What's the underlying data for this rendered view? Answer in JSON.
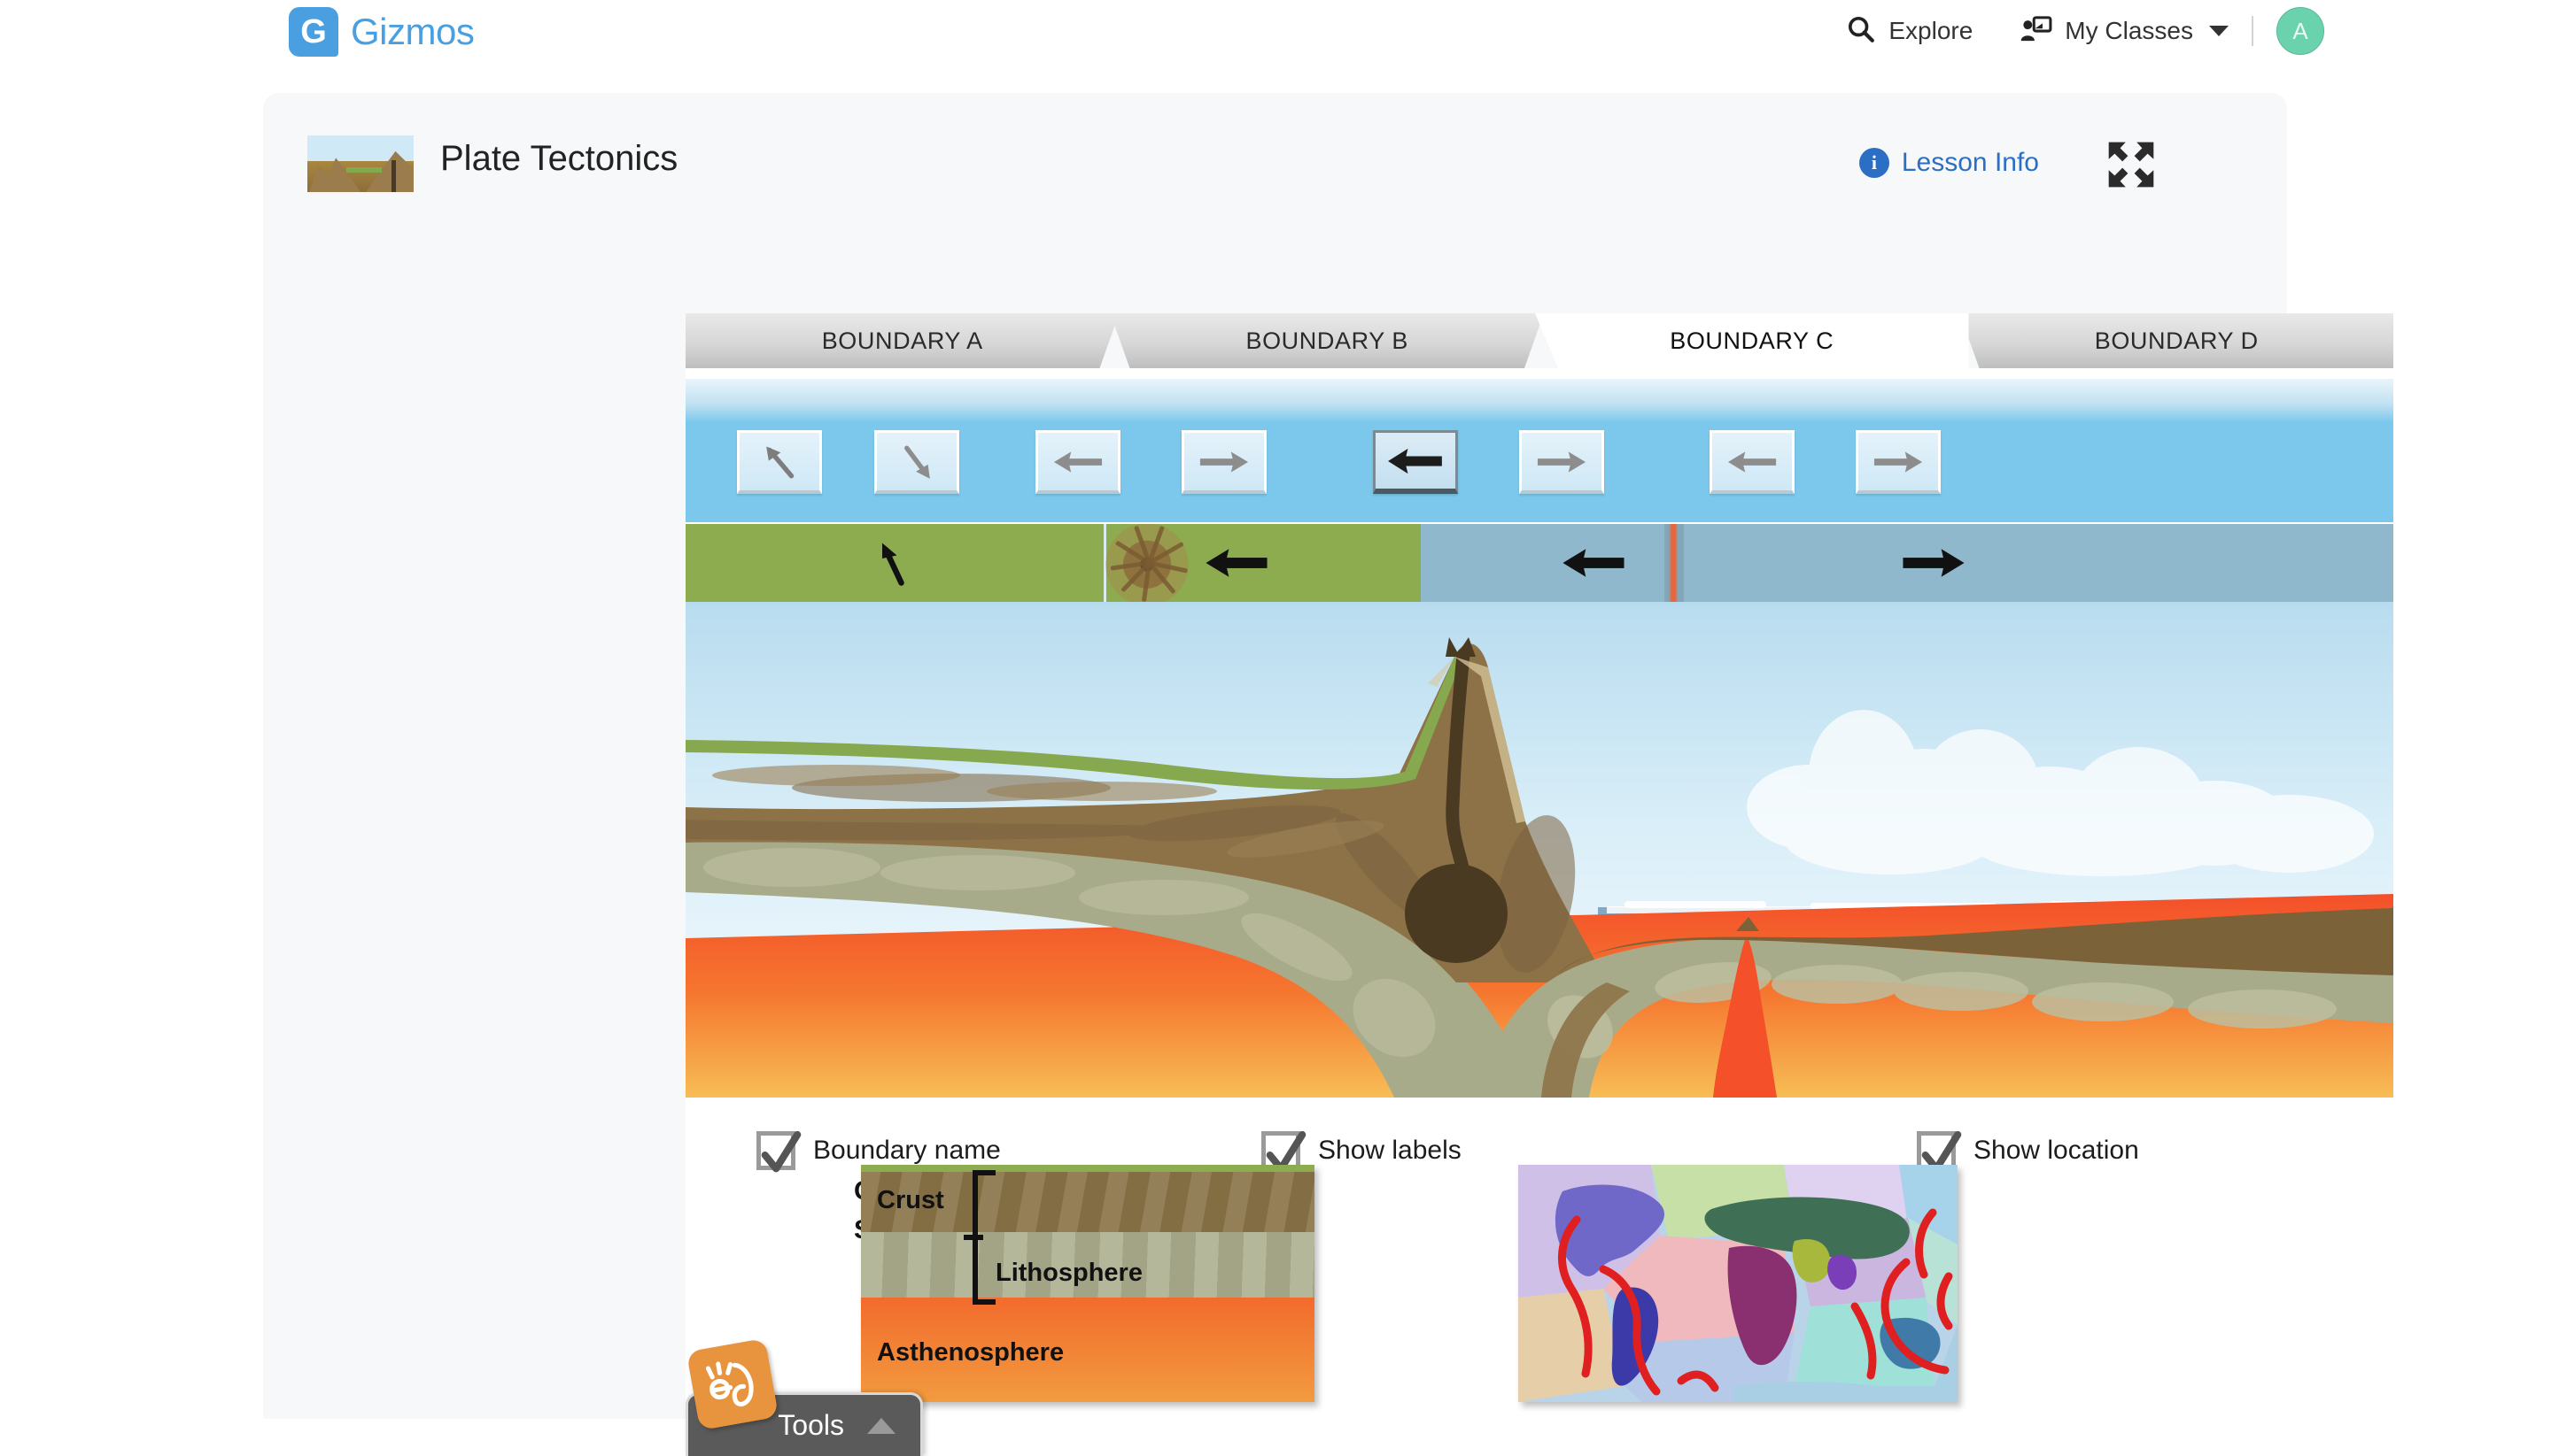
{
  "topnav": {
    "brand_mark": "G",
    "brand_text": "Gizmos",
    "explore_label": "Explore",
    "classes_label": "My Classes",
    "avatar_initial": "A",
    "search_icon": "search-icon",
    "classes_icon": "presenter-icon",
    "caret_icon": "chevron-down-icon"
  },
  "card_header": {
    "title": "Plate Tectonics",
    "thumbnail_icon": "plate-tectonics-thumbnail",
    "lesson_info_label": "Lesson Info",
    "info_icon": "info-icon",
    "info_glyph": "i",
    "fullscreen_icon": "fullscreen-expand-icon"
  },
  "tabs": [
    {
      "label": "BOUNDARY A",
      "active": false
    },
    {
      "label": "BOUNDARY B",
      "active": false
    },
    {
      "label": "BOUNDARY C",
      "active": true
    },
    {
      "label": "BOUNDARY D",
      "active": false
    }
  ],
  "simulation": {
    "plate_motion_buttons": [
      {
        "name": "arrow-up-left-button",
        "direction": "up-left",
        "selected": false
      },
      {
        "name": "arrow-down-right-button",
        "direction": "down-right",
        "selected": false
      },
      {
        "name": "arrow-left-button-1",
        "direction": "left",
        "selected": false
      },
      {
        "name": "arrow-right-button-1",
        "direction": "right",
        "selected": false
      },
      {
        "name": "arrow-left-button-2",
        "direction": "left",
        "selected": true
      },
      {
        "name": "arrow-right-button-2",
        "direction": "right",
        "selected": false
      },
      {
        "name": "arrow-left-button-3",
        "direction": "left",
        "selected": false
      },
      {
        "name": "arrow-right-button-3",
        "direction": "right",
        "selected": false
      }
    ],
    "plates": [
      {
        "name": "plate-1",
        "terrain": "land",
        "arrow": "up-left"
      },
      {
        "name": "plate-2",
        "terrain": "land",
        "arrow": "left"
      },
      {
        "name": "plate-3",
        "terrain": "ocean",
        "arrow": "left"
      },
      {
        "name": "plate-4",
        "terrain": "ocean",
        "arrow": "right"
      }
    ],
    "features": {
      "volcano_marker": "volcano-eruption-marker",
      "ridge_marker": "mid-ocean-ridge-marker"
    },
    "cross_section": {
      "name": "subduction-cross-section",
      "sky_color": "#cfe8f6",
      "ocean_color": "#7fa9c4",
      "crust_color": "#8d7248",
      "lithosphere_color": "#a8ab8a",
      "asthenosphere_top": "#f4502a",
      "asthenosphere_bottom": "#f6b84f",
      "grass_color": "#86a84e",
      "magma_conduit_color": "#4a3a22"
    }
  },
  "controls": {
    "boundary_name": {
      "label": "Boundary name",
      "checked": true,
      "value_line1": "Convergent boundaries:",
      "value_line2": "Subduction"
    },
    "show_labels": {
      "label": "Show labels",
      "checked": true,
      "legend": {
        "crust": "Crust",
        "lithosphere": "Lithosphere",
        "asthenosphere": "Asthenosphere"
      }
    },
    "show_location": {
      "label": "Show location",
      "checked": true,
      "map_name": "world-tectonic-plates-map"
    },
    "checkbox_border_color": "#9a9a9a",
    "check_color": "#555555"
  },
  "tools": {
    "label": "Tools",
    "caret_icon": "chevron-up-icon",
    "icon_name": "explorelearning-logo-icon",
    "icon_color": "#e8943f"
  }
}
